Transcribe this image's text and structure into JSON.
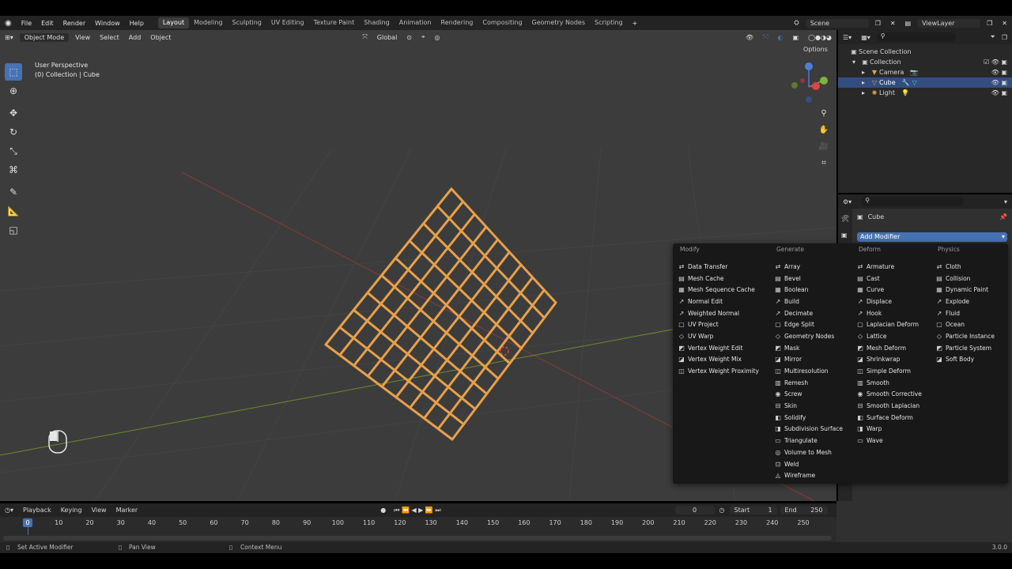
{
  "menu": {
    "file": "File",
    "edit": "Edit",
    "render": "Render",
    "window": "Window",
    "help": "Help"
  },
  "workspaces": [
    "Layout",
    "Modeling",
    "Sculpting",
    "UV Editing",
    "Texture Paint",
    "Shading",
    "Animation",
    "Rendering",
    "Compositing",
    "Geometry Nodes",
    "Scripting"
  ],
  "active_workspace": "Layout",
  "scene_name": "Scene",
  "view_layer": "ViewLayer",
  "viewport": {
    "mode": "Object Mode",
    "view_menu": "View",
    "select_menu": "Select",
    "add_menu": "Add",
    "object_menu": "Object",
    "orientation": "Global",
    "options": "Options",
    "overlay_title": "User Perspective",
    "overlay_subtitle": "(0) Collection | Cube"
  },
  "outliner": {
    "scene_collection": "Scene Collection",
    "collection": "Collection",
    "items": [
      "Camera",
      "Cube",
      "Light"
    ]
  },
  "properties": {
    "object_name": "Cube",
    "add_modifier": "Add Modifier"
  },
  "modifier_menu": {
    "columns": [
      {
        "header": "Modify",
        "items": [
          "Data Transfer",
          "Mesh Cache",
          "Mesh Sequence Cache",
          "Normal Edit",
          "Weighted Normal",
          "UV Project",
          "UV Warp",
          "Vertex Weight Edit",
          "Vertex Weight Mix",
          "Vertex Weight Proximity"
        ]
      },
      {
        "header": "Generate",
        "items": [
          "Array",
          "Bevel",
          "Boolean",
          "Build",
          "Decimate",
          "Edge Split",
          "Geometry Nodes",
          "Mask",
          "Mirror",
          "Multiresolution",
          "Remesh",
          "Screw",
          "Skin",
          "Solidify",
          "Subdivision Surface",
          "Triangulate",
          "Volume to Mesh",
          "Weld",
          "Wireframe"
        ]
      },
      {
        "header": "Deform",
        "items": [
          "Armature",
          "Cast",
          "Curve",
          "Displace",
          "Hook",
          "Laplacian Deform",
          "Lattice",
          "Mesh Deform",
          "Shrinkwrap",
          "Simple Deform",
          "Smooth",
          "Smooth Corrective",
          "Smooth Laplacian",
          "Surface Deform",
          "Warp",
          "Wave"
        ]
      },
      {
        "header": "Physics",
        "items": [
          "Cloth",
          "Collision",
          "Dynamic Paint",
          "Explode",
          "Fluid",
          "Ocean",
          "Particle Instance",
          "Particle System",
          "Soft Body"
        ]
      }
    ]
  },
  "timeline": {
    "playback": "Playback",
    "keying": "Keying",
    "view": "View",
    "marker": "Marker",
    "current_frame": "0",
    "start_label": "Start",
    "start": "1",
    "end_label": "End",
    "end": "250",
    "ruler": [
      "0",
      "10",
      "20",
      "30",
      "40",
      "50",
      "60",
      "70",
      "80",
      "90",
      "100",
      "110",
      "120",
      "130",
      "140",
      "150",
      "160",
      "170",
      "180",
      "190",
      "200",
      "210",
      "220",
      "230",
      "240",
      "250"
    ]
  },
  "status": {
    "left": "Set Active Modifier",
    "middle": "Pan View",
    "right": "Context Menu",
    "version": "3.0.0"
  },
  "colors": {
    "accent": "#4772b3",
    "wire": "#e8a04a",
    "x_axis": "#8a3a3a",
    "y_axis": "#6f8a2a"
  }
}
